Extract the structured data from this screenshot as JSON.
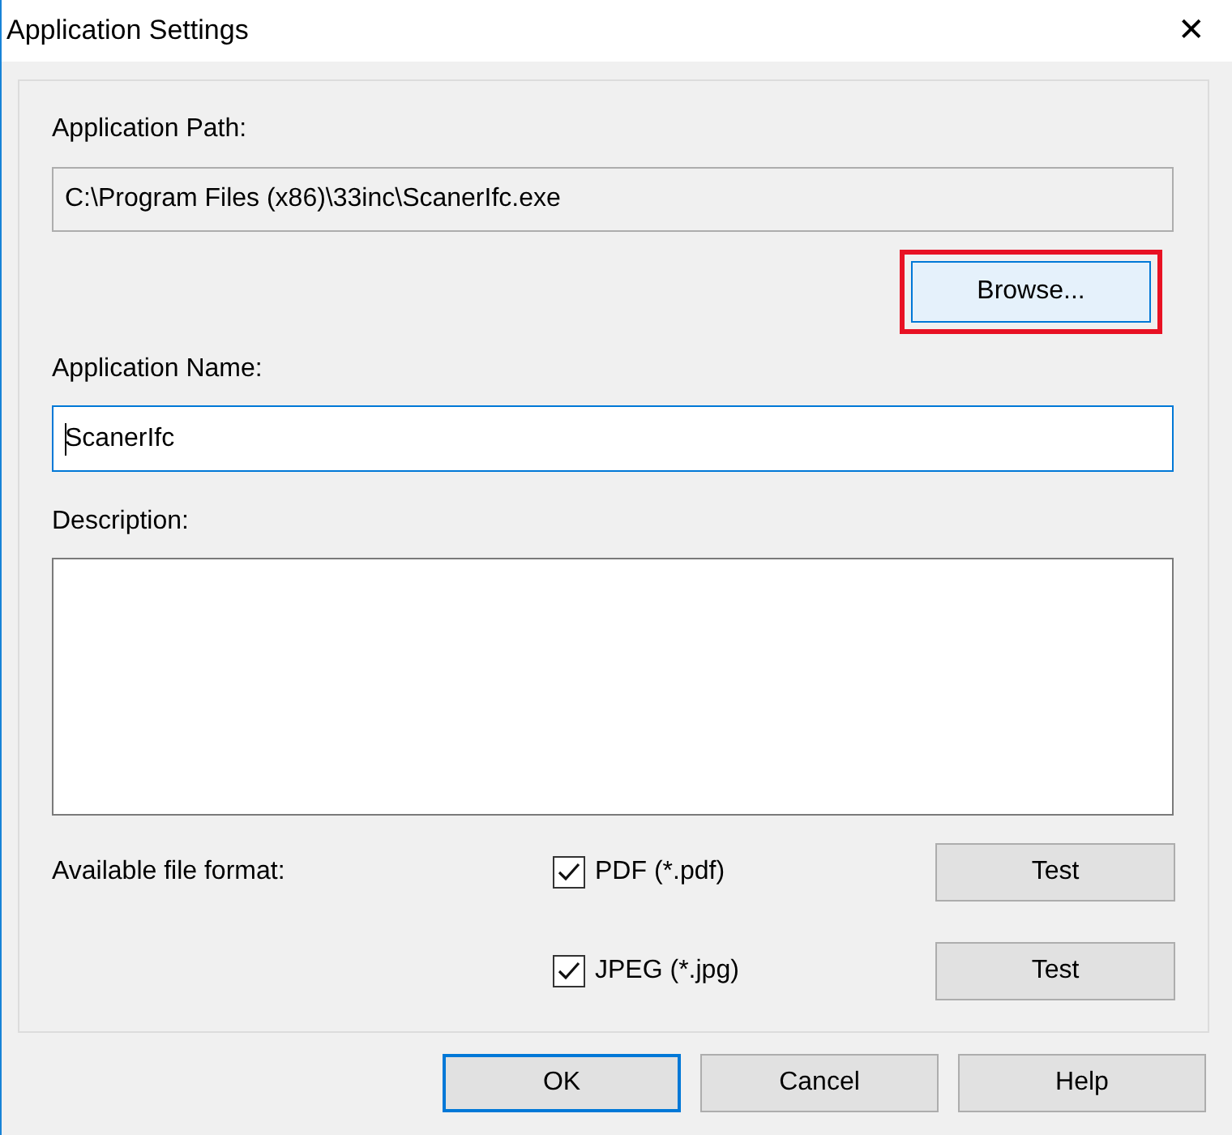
{
  "window": {
    "title": "Application Settings",
    "close": "✕"
  },
  "path": {
    "label": "Application Path:",
    "value": "C:\\Program Files (x86)\\33inc\\ScanerIfc.exe",
    "browse": "Browse...",
    "highlighted": true
  },
  "name": {
    "label": "Application Name:",
    "value": "ScanerIfc",
    "focused": true
  },
  "description": {
    "label": "Description:"
  },
  "formats": {
    "label": "Available file format:",
    "items": [
      {
        "label": "PDF (*.pdf)",
        "checked": true,
        "test": "Test"
      },
      {
        "label": "JPEG (*.jpg)",
        "checked": true,
        "test": "Test"
      }
    ]
  },
  "buttons": [
    {
      "label": "OK",
      "default": true
    },
    {
      "label": "Cancel",
      "default": false
    },
    {
      "label": "Help",
      "default": false
    }
  ]
}
